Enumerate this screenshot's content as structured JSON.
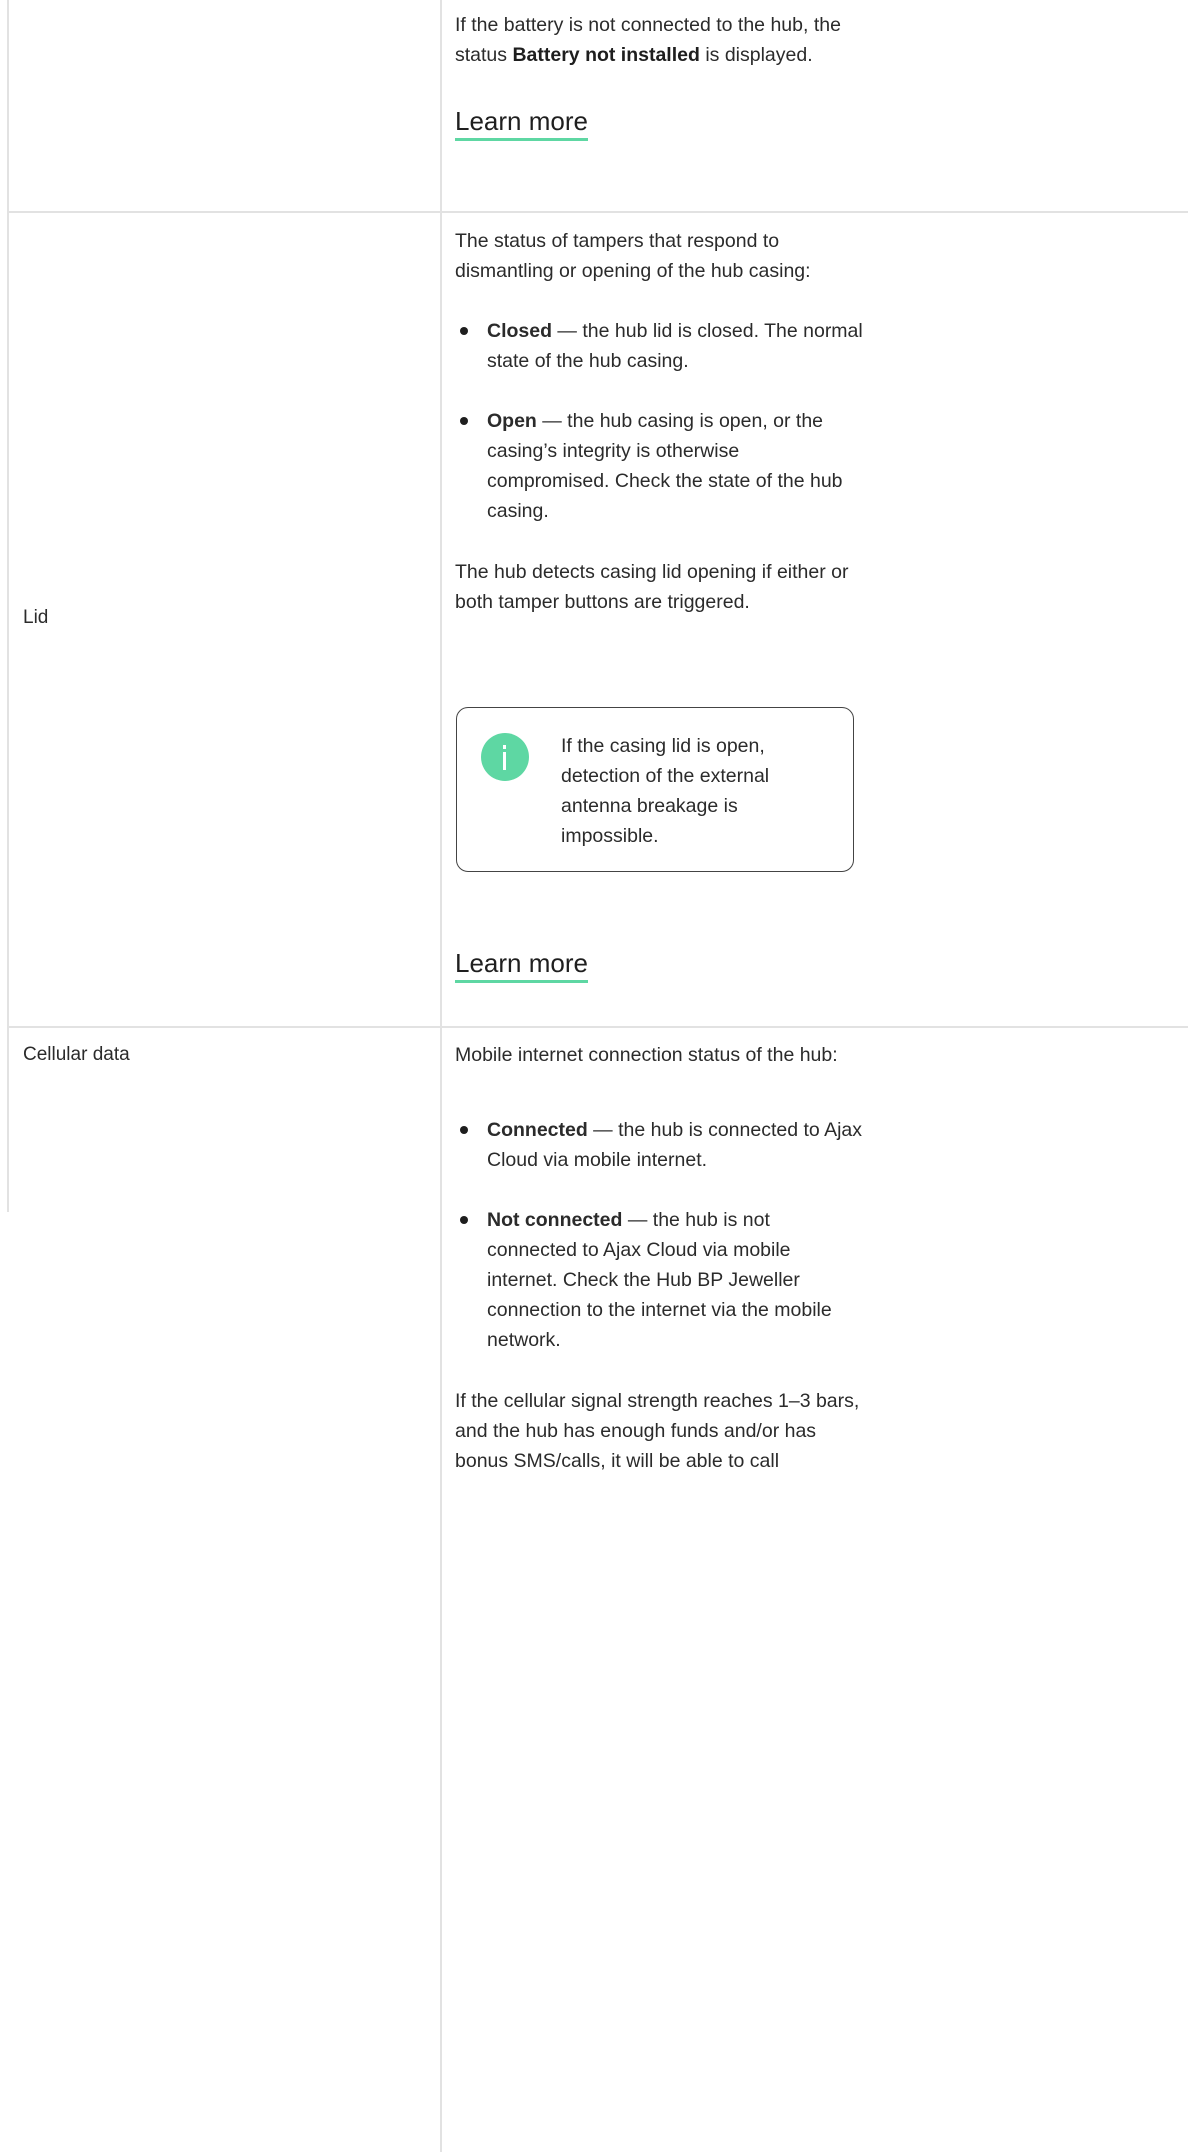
{
  "battery_row": {
    "text_pre": "If the battery is not connected to the hub, the status ",
    "text_bold": "Battery not installed",
    "text_post": " is displayed.",
    "learn_more": "Learn more"
  },
  "lid_row": {
    "label": "Lid",
    "intro": "The status of tampers that respond to dismantling or opening of the hub casing:",
    "items": [
      {
        "bold": "Closed",
        "text": " — the hub lid is closed. The normal state of the hub casing."
      },
      {
        "bold": "Open",
        "text": " — the hub casing is open, or the casing’s integrity is otherwise compromised. Check the state of the hub casing."
      }
    ],
    "detect_text": "The hub detects casing lid opening if either or both tamper buttons are triggered.",
    "note": "If the casing lid is open, detection of the external antenna breakage is impossible.",
    "learn_more": "Learn more"
  },
  "cellular_row": {
    "label": "Cellular data",
    "intro": "Mobile internet connection status of the hub:",
    "items": [
      {
        "bold": "Connected",
        "text": " — the hub is connected to Ajax Cloud via mobile internet."
      },
      {
        "bold": "Not connected",
        "text": " — the hub is not connected to Ajax Cloud via mobile internet. Check the Hub BP Jeweller connection to the internet via the mobile network."
      }
    ],
    "signal_text": "If the cellular signal strength reaches 1–3 bars, and the hub has enough funds and/or has bonus SMS/calls, it will be able to call"
  }
}
